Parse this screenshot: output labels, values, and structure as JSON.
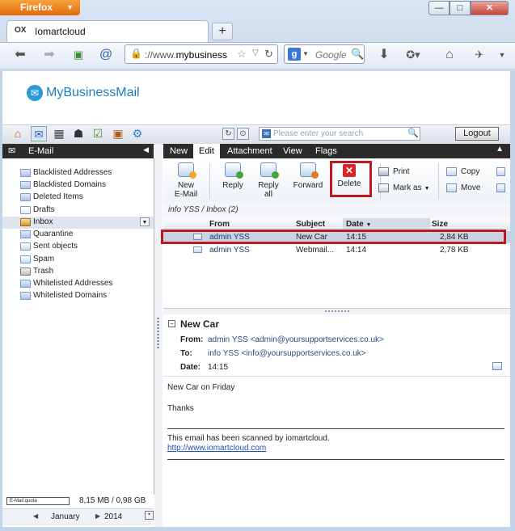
{
  "browser": {
    "menu_label": "Firefox",
    "tab_title": "Iomartcloud",
    "tab_favicon": "OX",
    "url_prefix": "://www.",
    "url_domain": "mybusiness",
    "search_engine_letter": "g",
    "search_placeholder": "Google"
  },
  "brand": {
    "name": "MyBusinessMail"
  },
  "app_toolbar": {
    "search_placeholder": "Please enter your search",
    "logout_label": "Logout"
  },
  "left_panel": {
    "title": "E-Mail",
    "folders": [
      {
        "label": "Blacklisted Addresses"
      },
      {
        "label": "Blacklisted Domains"
      },
      {
        "label": "Deleted Items"
      },
      {
        "label": "Drafts"
      },
      {
        "label": "Inbox"
      },
      {
        "label": "Quarantine"
      },
      {
        "label": "Sent objects"
      },
      {
        "label": "Spam"
      },
      {
        "label": "Trash"
      },
      {
        "label": "Whitelisted Addresses"
      },
      {
        "label": "Whitelisted Domains"
      }
    ],
    "quota_label": "E-Mail quota",
    "quota_value": "8,15 MB / 0,98 GB",
    "calendar_month": "January",
    "calendar_year": "2014"
  },
  "ribbon": {
    "tabs": [
      "New",
      "Edit",
      "Attachment",
      "View",
      "Flags"
    ],
    "buttons": {
      "new_email": "New E-Mail",
      "new_email_l1": "New",
      "new_email_l2": "E-Mail",
      "reply": "Reply",
      "reply_all_l1": "Reply",
      "reply_all_l2": "all",
      "forward": "Forward",
      "delete": "Delete",
      "print": "Print",
      "mark_as": "Mark as",
      "copy": "Copy",
      "move": "Move"
    }
  },
  "mail_list": {
    "path": "info YSS / Inbox (2)",
    "columns": {
      "from": "From",
      "subject": "Subject",
      "date": "Date",
      "size": "Size"
    },
    "rows": [
      {
        "from": "admin YSS",
        "subject": "New Car",
        "date": "14:15",
        "size": "2,84 KB"
      },
      {
        "from": "admin YSS",
        "subject": "Webmail...",
        "date": "14:14",
        "size": "2,78 KB"
      }
    ]
  },
  "preview": {
    "subject": "New Car",
    "from_label": "From:",
    "from_value": "admin YSS <admin@yoursupportservices.co.uk>",
    "to_label": "To:",
    "to_value": "info YSS <info@yoursupportservices.co.uk>",
    "date_label": "Date:",
    "date_value": "14:15",
    "body_line1": "New Car on Friday",
    "body_line2": "Thanks",
    "footer_text": "This email has been scanned by iomartcloud.",
    "footer_link": "http://www.iomartcloud.com"
  },
  "colors": {
    "highlight": "#c0181f",
    "delete_icon": "#d9242a",
    "brand_blue": "#1a7cc1"
  }
}
